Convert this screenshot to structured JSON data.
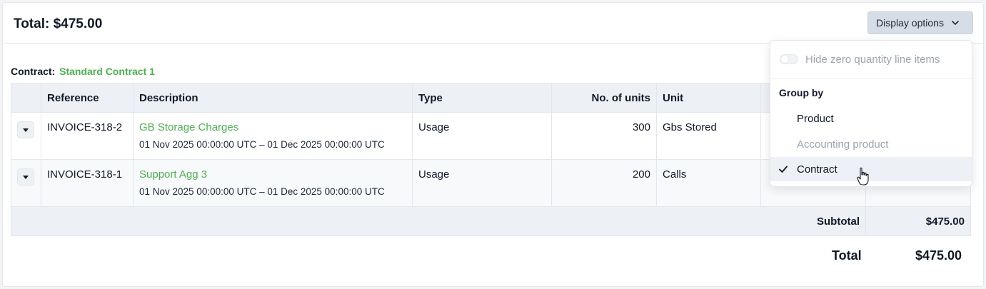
{
  "header": {
    "title": "Total: $475.00",
    "display_options_label": "Display options"
  },
  "contract": {
    "prefix": "Contract:",
    "name": "Standard Contract 1"
  },
  "table": {
    "columns": [
      "Reference",
      "Description",
      "Type",
      "No. of units",
      "Unit"
    ],
    "rows": [
      {
        "reference": "INVOICE-318-2",
        "description": "GB Storage Charges",
        "period": "01 Nov 2025 00:00:00 UTC – 01 Dec 2025 00:00:00 UTC",
        "type": "Usage",
        "units": "300",
        "unit": "Gbs Stored"
      },
      {
        "reference": "INVOICE-318-1",
        "description": "Support Agg 3",
        "period": "01 Nov 2025 00:00:00 UTC – 01 Dec 2025 00:00:00 UTC",
        "type": "Usage",
        "units": "200",
        "unit": "Calls"
      }
    ],
    "subtotal_label": "Subtotal",
    "subtotal_value": "$475.00"
  },
  "total": {
    "label": "Total",
    "value": "$475.00"
  },
  "dropdown": {
    "hide_zero_label": "Hide zero quantity line items",
    "hide_zero_enabled": false,
    "group_by_heading": "Group by",
    "options": [
      {
        "label": "Product",
        "disabled": false,
        "selected": false
      },
      {
        "label": "Accounting product",
        "disabled": true,
        "selected": false
      },
      {
        "label": "Contract",
        "disabled": false,
        "selected": true
      }
    ]
  },
  "colors": {
    "accent_green": "#4caf50",
    "header_bg": "#edf1f5",
    "button_bg": "#d6dde6"
  }
}
